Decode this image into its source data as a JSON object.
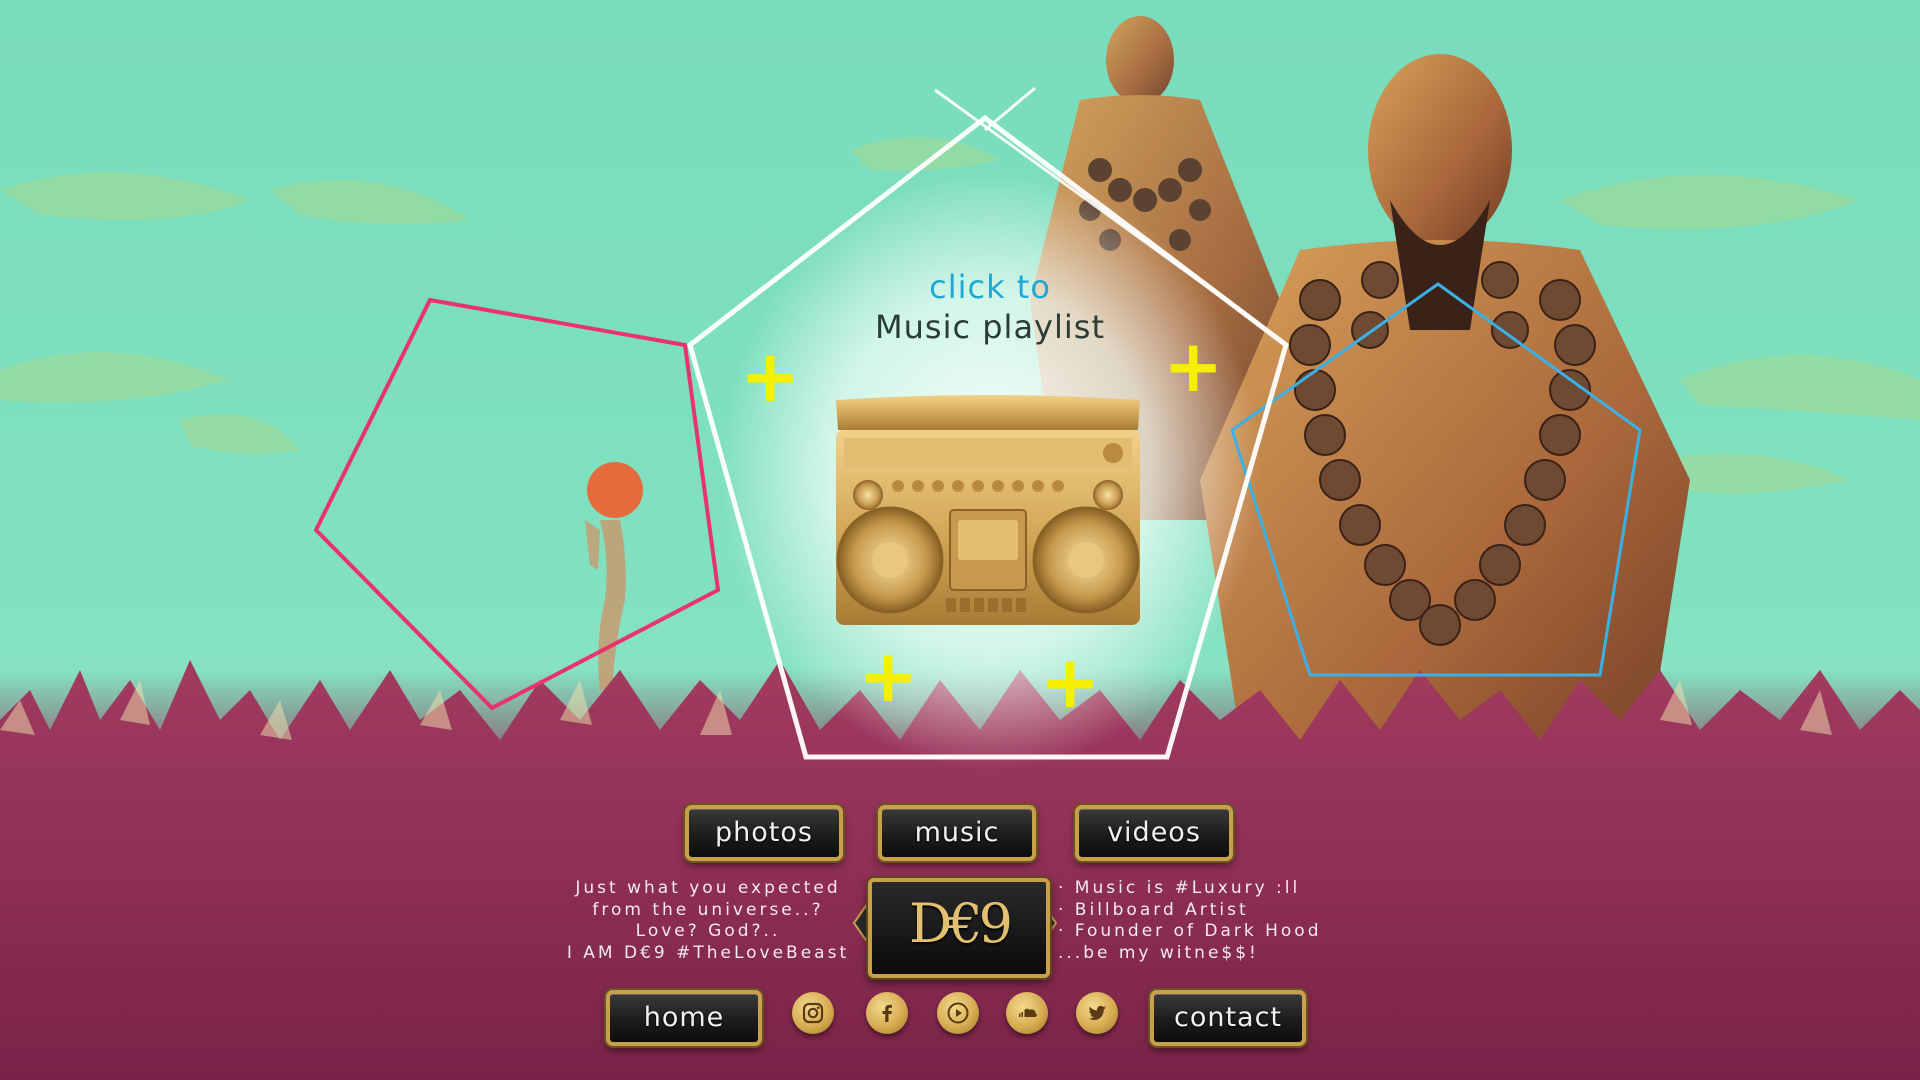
{
  "hero": {
    "click_label": "click to",
    "playlist_label": "Music playlist"
  },
  "nav": {
    "photos": "photos",
    "music": "music",
    "videos": "videos",
    "home": "home",
    "contact": "contact"
  },
  "tagline_left": [
    "Just what you expected",
    "from the universe..?",
    "Love? God?..",
    "I AM D€9 #TheLoveBeast"
  ],
  "tagline_right": [
    "· Music is #Luxury :ll",
    "· Billboard Artist",
    "· Founder of Dark Hood",
    "...be my witne$$!"
  ],
  "logo": {
    "text": "D€9"
  },
  "social_icons": [
    "instagram-icon",
    "facebook-icon",
    "youtube-icon",
    "soundcloud-icon",
    "twitter-icon"
  ],
  "colors": {
    "sky": "#7ee0bf",
    "grass": "#8a2b52",
    "gold": "#c9a04a",
    "accent_blue": "#1fa8d6",
    "pink_outline": "#e8336f",
    "plus_yellow": "#f4f000"
  }
}
